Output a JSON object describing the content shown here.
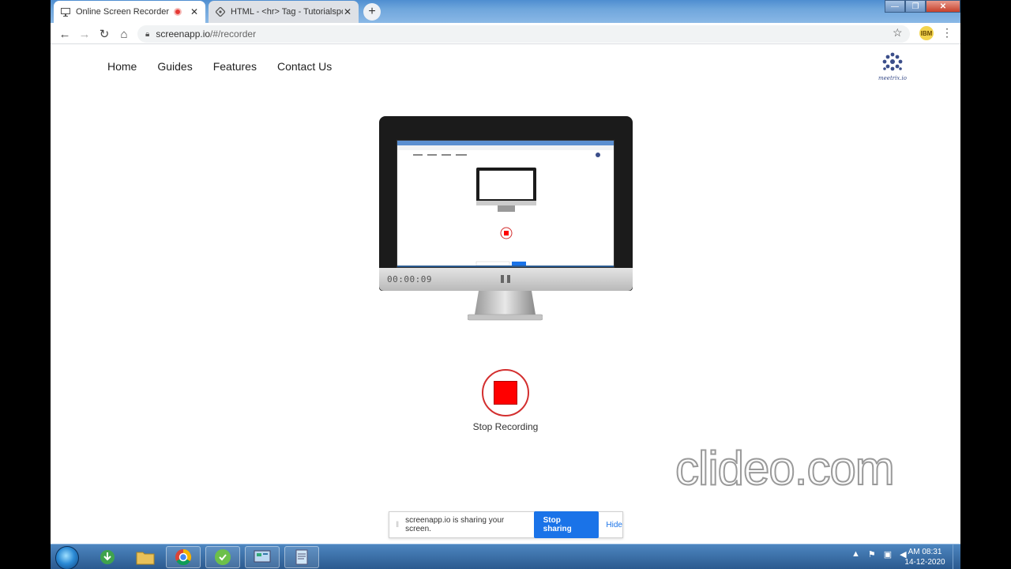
{
  "browser": {
    "tabs": [
      {
        "title": "Online Screen Recorder",
        "recording": true,
        "active": true
      },
      {
        "title": "HTML - <hr> Tag - Tutorialspoint",
        "active": false
      }
    ],
    "address": {
      "host": "screenapp.io",
      "path": "/#/recorder"
    },
    "extension_badge": "IBM"
  },
  "site": {
    "nav": [
      "Home",
      "Guides",
      "Features",
      "Contact Us"
    ],
    "logo_text": "meetrix.io"
  },
  "recorder": {
    "timer": "00:00:09",
    "stop_label": "Stop Recording",
    "stop_color": "#ff0000"
  },
  "sharing_bar": {
    "message": "screenapp.io is sharing your screen.",
    "stop_button": "Stop sharing",
    "hide_link": "Hide"
  },
  "watermark": "clideo.com",
  "taskbar": {
    "apps": [
      "start",
      "internet-download-manager",
      "file-explorer",
      "chrome",
      "app-green",
      "control-panel",
      "notepad"
    ],
    "clock": {
      "time": "AM 08:31",
      "date": "14-12-2020"
    }
  }
}
